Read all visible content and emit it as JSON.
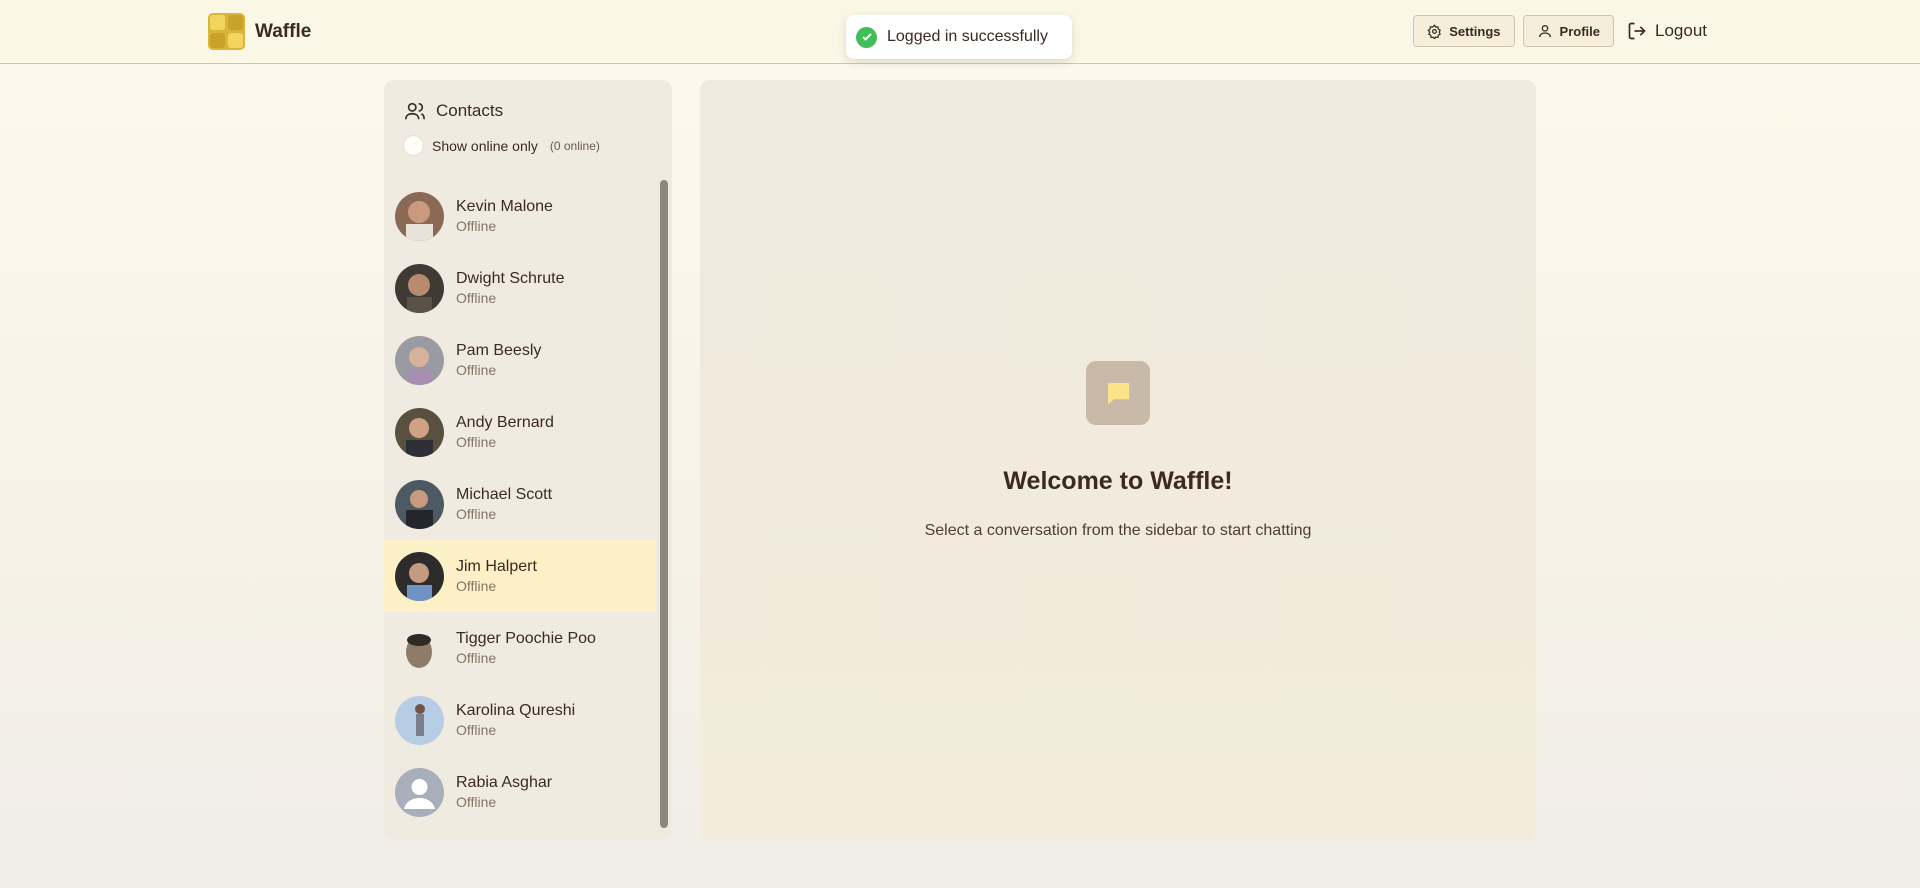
{
  "header": {
    "brand": "Waffle",
    "settings_label": "Settings",
    "profile_label": "Profile",
    "logout_label": "Logout"
  },
  "toast": {
    "message": "Logged in successfully"
  },
  "sidebar": {
    "title": "Contacts",
    "online_toggle_label": "Show online only",
    "online_count": "(0 online)",
    "contacts": [
      {
        "name": "Kevin Malone",
        "status": "Offline",
        "avatar": "photo"
      },
      {
        "name": "Dwight Schrute",
        "status": "Offline",
        "avatar": "photo"
      },
      {
        "name": "Pam Beesly",
        "status": "Offline",
        "avatar": "photo"
      },
      {
        "name": "Andy Bernard",
        "status": "Offline",
        "avatar": "photo"
      },
      {
        "name": "Michael Scott",
        "status": "Offline",
        "avatar": "photo"
      },
      {
        "name": "Jim Halpert",
        "status": "Offline",
        "avatar": "photo",
        "selected": true
      },
      {
        "name": "Tigger Poochie Poo",
        "status": "Offline",
        "avatar": "photo"
      },
      {
        "name": "Karolina Qureshi",
        "status": "Offline",
        "avatar": "photo"
      },
      {
        "name": "Rabia Asghar",
        "status": "Offline",
        "avatar": "placeholder"
      }
    ]
  },
  "main": {
    "welcome_title": "Welcome to Waffle!",
    "welcome_subtitle": "Select a conversation from the sidebar to start chatting"
  },
  "colors": {
    "accent": "#f2d55e",
    "selected_row": "#fcf0c7",
    "success": "#3fbf55",
    "text": "#3b2a22"
  },
  "icons": [
    "users-icon",
    "gear-icon",
    "user-icon",
    "logout-icon",
    "check-icon",
    "chat-bubble-icon"
  ]
}
